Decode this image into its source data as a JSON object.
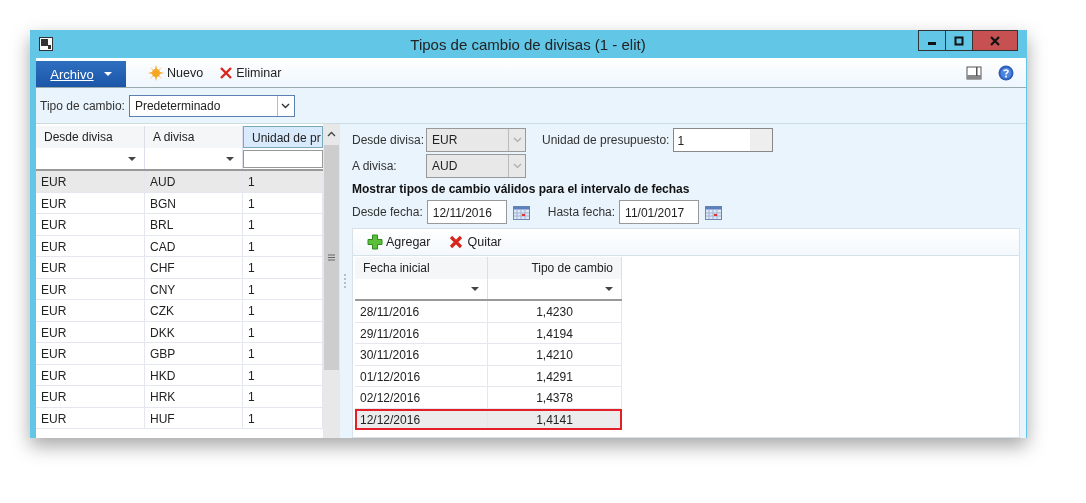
{
  "window": {
    "title": "Tipos de cambio de divisas (1 - elit)"
  },
  "toolbar": {
    "file_menu": "Archivo",
    "buttons": [
      {
        "kind": "new",
        "label": "Nuevo"
      },
      {
        "kind": "delete",
        "label": "Eliminar"
      }
    ]
  },
  "exchange_type": {
    "label": "Tipo de cambio:",
    "value": "Predeterminado"
  },
  "currency_grid": {
    "columns": [
      "Desde divisa",
      "A divisa",
      "Unidad de pr"
    ],
    "rows": [
      {
        "from": "EUR",
        "to": "AUD",
        "unit": "1",
        "selected": true
      },
      {
        "from": "EUR",
        "to": "BGN",
        "unit": "1",
        "selected": false
      },
      {
        "from": "EUR",
        "to": "BRL",
        "unit": "1",
        "selected": false
      },
      {
        "from": "EUR",
        "to": "CAD",
        "unit": "1",
        "selected": false
      },
      {
        "from": "EUR",
        "to": "CHF",
        "unit": "1",
        "selected": false
      },
      {
        "from": "EUR",
        "to": "CNY",
        "unit": "1",
        "selected": false
      },
      {
        "from": "EUR",
        "to": "CZK",
        "unit": "1",
        "selected": false
      },
      {
        "from": "EUR",
        "to": "DKK",
        "unit": "1",
        "selected": false
      },
      {
        "from": "EUR",
        "to": "GBP",
        "unit": "1",
        "selected": false
      },
      {
        "from": "EUR",
        "to": "HKD",
        "unit": "1",
        "selected": false
      },
      {
        "from": "EUR",
        "to": "HRK",
        "unit": "1",
        "selected": false
      },
      {
        "from": "EUR",
        "to": "HUF",
        "unit": "1",
        "selected": false
      }
    ]
  },
  "detail": {
    "from_label": "Desde divisa:",
    "from_value": "EUR",
    "unit_label": "Unidad de presupuesto:",
    "unit_value": "1",
    "to_label": "A divisa:",
    "to_value": "AUD",
    "section_title": "Mostrar tipos de cambio válidos para el intervalo de fechas",
    "date_from_label": "Desde fecha:",
    "date_from": "12/11/2016",
    "date_to_label": "Hasta fecha:",
    "date_to": "11/01/2017",
    "grid_buttons": [
      {
        "kind": "add",
        "label": "Agregar"
      },
      {
        "kind": "remove",
        "label": "Quitar"
      }
    ],
    "rates_grid": {
      "columns": [
        "Fecha inicial",
        "Tipo de cambio"
      ],
      "rows": [
        {
          "date": "28/11/2016",
          "rate": "1,4230",
          "selected": false
        },
        {
          "date": "29/11/2016",
          "rate": "1,4194",
          "selected": false
        },
        {
          "date": "30/11/2016",
          "rate": "1,4210",
          "selected": false
        },
        {
          "date": "01/12/2016",
          "rate": "1,4291",
          "selected": false
        },
        {
          "date": "02/12/2016",
          "rate": "1,4378",
          "selected": false
        },
        {
          "date": "12/12/2016",
          "rate": "1,4141",
          "selected": true
        }
      ]
    }
  }
}
